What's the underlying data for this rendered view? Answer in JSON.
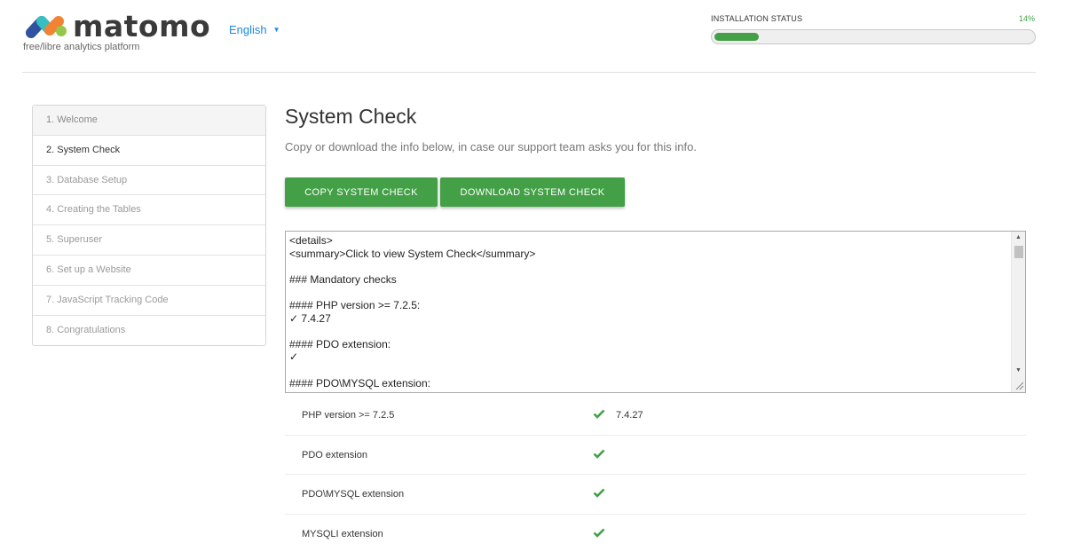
{
  "brand": {
    "name": "matomo",
    "tagline": "free/libre analytics platform",
    "colors": {
      "blue": "#3152a0",
      "teal": "#35bfc0",
      "orange": "#f38334",
      "green": "#95c748"
    }
  },
  "language": {
    "selected": "English",
    "icon": "caret-down-icon"
  },
  "installation": {
    "label": "INSTALLATION STATUS",
    "percent_text": "14%",
    "progress": 0.14
  },
  "steps": [
    {
      "label": "1. Welcome"
    },
    {
      "label": "2. System Check"
    },
    {
      "label": "3. Database Setup"
    },
    {
      "label": "4. Creating the Tables"
    },
    {
      "label": "5. Superuser"
    },
    {
      "label": "6. Set up a Website"
    },
    {
      "label": "7. JavaScript Tracking Code"
    },
    {
      "label": "8. Congratulations"
    }
  ],
  "main": {
    "title": "System Check",
    "subtitle": "Copy or download the info below, in case our support team asks you for this info.",
    "buttons": {
      "copy": "COPY SYSTEM CHECK",
      "download": "DOWNLOAD SYSTEM CHECK"
    },
    "report_lines": [
      "<details>",
      "<summary>Click to view System Check</summary>",
      "",
      "### Mandatory checks",
      "",
      "#### PHP version >= 7.2.5:",
      "✓ 7.4.27",
      "",
      "#### PDO extension:",
      "✓",
      "",
      "#### PDO\\MYSQL extension:"
    ],
    "checks": [
      {
        "label": "PHP version >= 7.2.5",
        "value": "7.4.27"
      },
      {
        "label": "PDO extension",
        "value": ""
      },
      {
        "label": "PDO\\MYSQL extension",
        "value": ""
      },
      {
        "label": "MYSQLI extension",
        "value": ""
      }
    ],
    "accent": "#43a047"
  }
}
